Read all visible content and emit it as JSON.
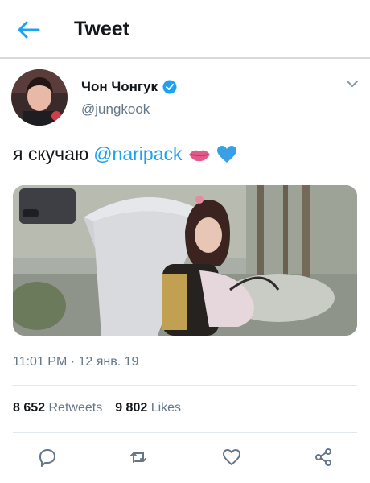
{
  "header": {
    "title": "Tweet",
    "back_icon": "arrow-left-icon"
  },
  "tweet": {
    "author": {
      "display_name": "Чон Чонгук",
      "handle": "@jungkook",
      "verified": true
    },
    "text_prefix": "я скучаю",
    "mention": "@naripack",
    "emojis": [
      "kiss-lips-emoji",
      "blue-heart-emoji"
    ],
    "timestamp": "11:01 PM · 12 янв. 19",
    "stats": {
      "retweets_count": "8 652",
      "retweets_label": "Retweets",
      "likes_count": "9 802",
      "likes_label": "Likes"
    },
    "actions": [
      "reply-icon",
      "retweet-icon",
      "like-icon",
      "share-icon"
    ]
  },
  "colors": {
    "accent": "#1da1f2",
    "text_primary": "#14171a",
    "text_secondary": "#657786"
  }
}
